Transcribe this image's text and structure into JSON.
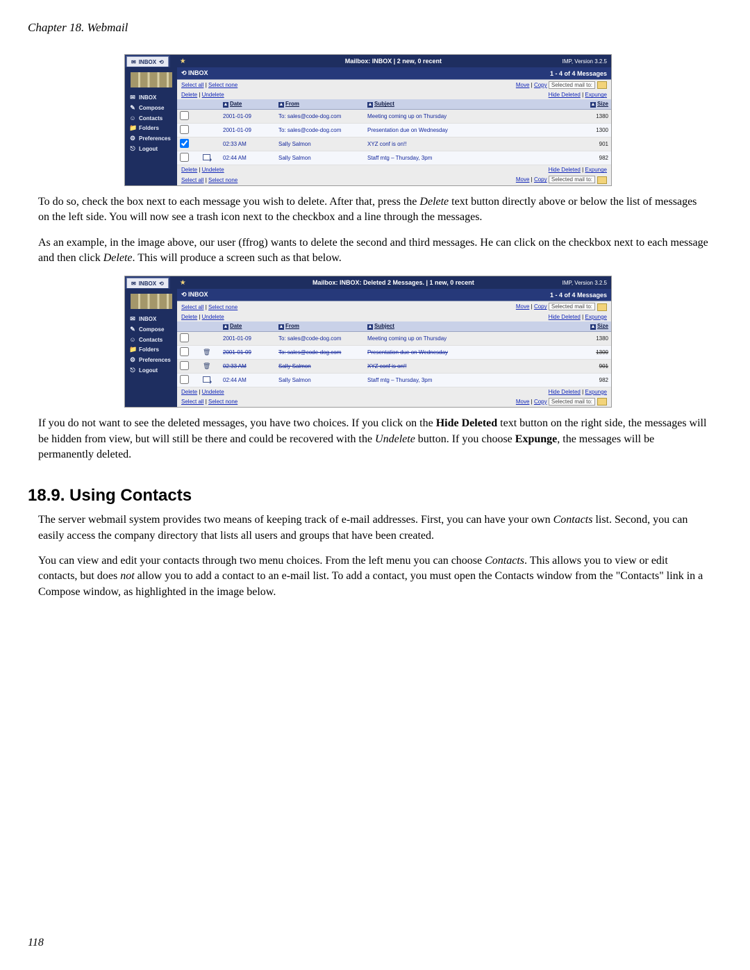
{
  "chapter_header": "Chapter 18. Webmail",
  "page_number": "118",
  "section_heading": "18.9. Using Contacts",
  "paragraphs": {
    "p1_a": "To do so, check the box next to each message you wish to delete. After that, press the ",
    "p1_delete": "Delete",
    "p1_b": " text button directly above or below the list of messages on the left side. You will now see a trash icon next to the checkbox and a line through the messages.",
    "p2_a": "As an example, in the image above, our user (ffrog) wants to delete the second and third messages. He can click on the checkbox next to each message and then click ",
    "p2_delete": "Delete",
    "p2_b": ". This will produce a screen such as that below.",
    "p3_a": "If you do not want to see the deleted messages, you have two choices. If you click on the ",
    "p3_hidedel": "Hide Deleted",
    "p3_b": " text button on the right side, the messages will be hidden from view, but will still be there and could be recovered with the ",
    "p3_undel": "Undelete",
    "p3_c": " button. If you choose ",
    "p3_expunge": "Expunge",
    "p3_d": ", the messages will be permanently deleted.",
    "p4_a": "The server webmail system provides two means of keeping track of e-mail addresses. First, you can have your own ",
    "p4_contacts": "Contacts",
    "p4_b": " list. Second, you can easily access the company directory that lists all users and groups that have been created.",
    "p5_a": "You can view and edit your contacts through two menu choices. From the left menu you can choose ",
    "p5_contacts": "Contacts",
    "p5_b": ". This allows you to view or edit contacts, but does ",
    "p5_not": "not",
    "p5_c": " allow you to add a contact to an e-mail list. To add a contact, you must open the Contacts window from the \"Contacts\" link in a Compose window, as highlighted in the image below."
  },
  "webmail_common": {
    "tab_label": "INBOX",
    "help_icon_title": "Help",
    "version_label": "IMP, Version 3.2.5",
    "sidebar": {
      "items": [
        {
          "icon": "✉",
          "label": "INBOX",
          "name": "sidebar-item-inbox"
        },
        {
          "icon": "✎",
          "label": "Compose",
          "name": "sidebar-item-compose"
        },
        {
          "icon": "☺",
          "label": "Contacts",
          "name": "sidebar-item-contacts"
        },
        {
          "icon": "📁",
          "label": "Folders",
          "name": "sidebar-item-folders"
        },
        {
          "icon": "⚙",
          "label": "Preferences",
          "name": "sidebar-item-preferences"
        },
        {
          "icon": "⎋",
          "label": "Logout",
          "name": "sidebar-item-logout"
        }
      ]
    },
    "bluebar_left": "INBOX",
    "bluebar_right": "1 - 4 of 4 Messages",
    "select_all": "Select all",
    "select_none": "Select none",
    "move": "Move",
    "copy": "Copy",
    "dest_label": "Selected mail to:",
    "delete": "Delete",
    "undelete": "Undelete",
    "hide_deleted": "Hide Deleted",
    "expunge": "Expunge",
    "columns": {
      "date": "Date",
      "from": "From",
      "subject": "Subject",
      "size": "Size"
    }
  },
  "fig1": {
    "top_title": "Mailbox: INBOX | 2 new, 0 recent",
    "rows": [
      {
        "checked": false,
        "deleted": false,
        "reply": false,
        "date": "2001-01-09",
        "from": "To: sales@code-dog.com",
        "subject": "Meeting coming up on Thursday",
        "size": "1380"
      },
      {
        "checked": false,
        "deleted": false,
        "reply": false,
        "date": "2001-01-09",
        "from": "To: sales@code-dog.com",
        "subject": "Presentation due on Wednesday",
        "size": "1300"
      },
      {
        "checked": true,
        "deleted": false,
        "reply": false,
        "date": "02:33 AM",
        "from": "Sally Salmon",
        "subject": "XYZ conf is on!!",
        "size": "901"
      },
      {
        "checked": false,
        "deleted": false,
        "reply": true,
        "date": "02:44 AM",
        "from": "Sally Salmon",
        "subject": "Staff mtg – Thursday, 3pm",
        "size": "982"
      }
    ]
  },
  "fig2": {
    "top_title": "Mailbox: INBOX: Deleted 2 Messages. | 1 new, 0 recent",
    "rows": [
      {
        "checked": false,
        "deleted": false,
        "reply": false,
        "date": "2001-01-09",
        "from": "To: sales@code-dog.com",
        "subject": "Meeting coming up on Thursday",
        "size": "1380"
      },
      {
        "checked": false,
        "deleted": true,
        "reply": false,
        "date": "2001-01-09",
        "from": "To: sales@code-dog.com",
        "subject": "Presentation due on Wednesday",
        "size": "1300"
      },
      {
        "checked": false,
        "deleted": true,
        "reply": false,
        "date": "02:33 AM",
        "from": "Sally Salmon",
        "subject": "XYZ conf is on!!",
        "size": "901"
      },
      {
        "checked": false,
        "deleted": false,
        "reply": true,
        "date": "02:44 AM",
        "from": "Sally Salmon",
        "subject": "Staff mtg – Thursday, 3pm",
        "size": "982"
      }
    ]
  }
}
